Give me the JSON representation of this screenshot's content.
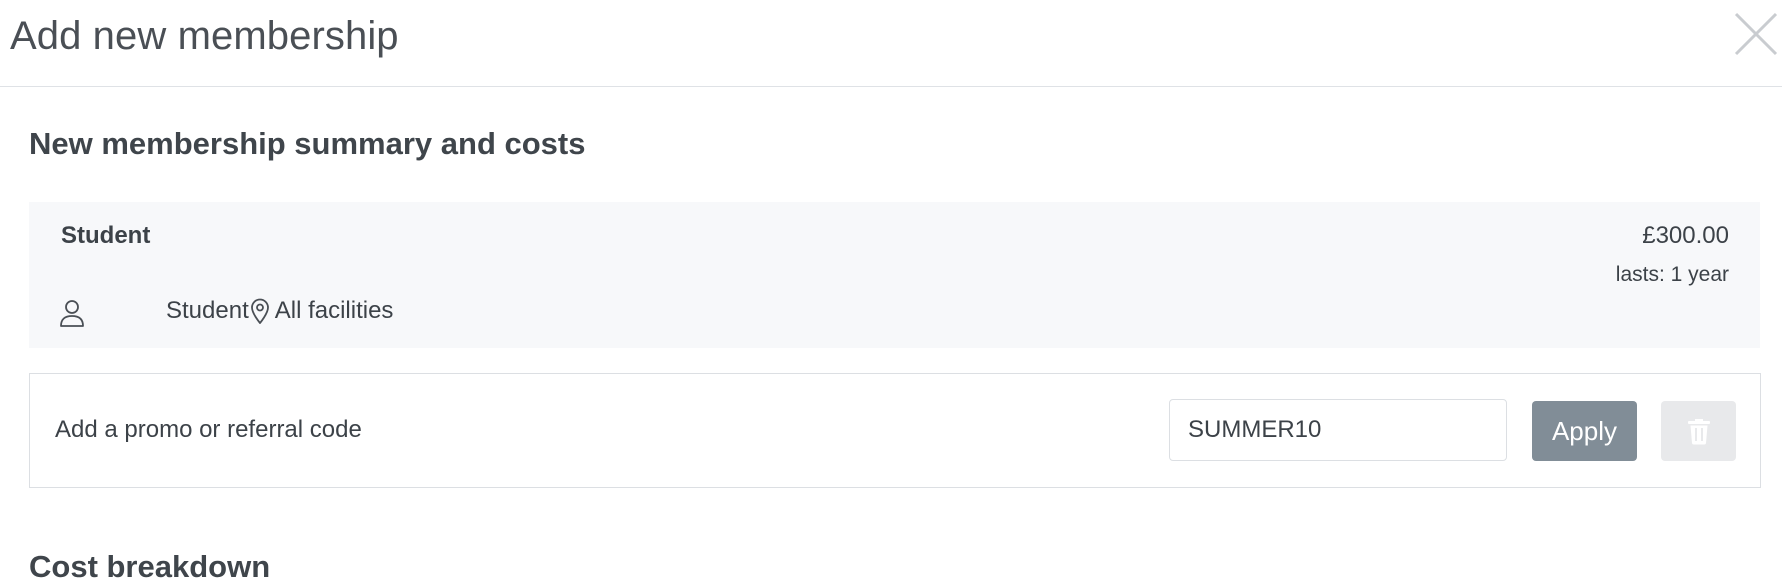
{
  "modal": {
    "title": "Add new membership",
    "close_icon": "close-icon"
  },
  "summary": {
    "section_title": "New membership summary and costs",
    "membership_name": "Student",
    "price": "£300.00",
    "duration": "lasts: 1 year",
    "audience": "Student",
    "location": "All facilities",
    "icons": {
      "audience": "person-icon",
      "location": "location-pin-icon"
    }
  },
  "promo": {
    "label": "Add a promo or referral code",
    "code_value": "SUMMER10",
    "apply_label": "Apply",
    "delete_icon": "trash-icon"
  },
  "next_section": {
    "title": "Cost breakdown"
  },
  "colors": {
    "apply_button": "#818d97",
    "card_background": "#f7f8fa",
    "delete_button": "#e8e9eb",
    "text": "#3c4248"
  }
}
